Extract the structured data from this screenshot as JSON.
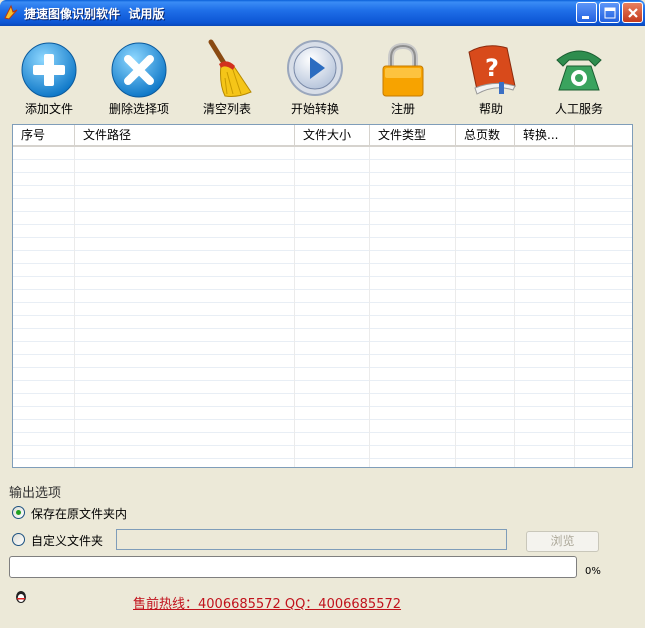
{
  "window": {
    "title": "捷速图像识别软件  试用版"
  },
  "toolbar": {
    "items": [
      {
        "label": "添加文件",
        "icon": "plus-icon"
      },
      {
        "label": "删除选择项",
        "icon": "delete-x-icon"
      },
      {
        "label": "清空列表",
        "icon": "broom-icon"
      },
      {
        "label": "开始转换",
        "icon": "play-icon"
      },
      {
        "label": "注册",
        "icon": "lock-icon"
      },
      {
        "label": "帮助",
        "icon": "help-book-icon"
      },
      {
        "label": "人工服务",
        "icon": "telephone-icon"
      }
    ]
  },
  "file_list": {
    "columns": [
      "序号",
      "文件路径",
      "文件大小",
      "文件类型",
      "总页数",
      "转换..."
    ],
    "rows": []
  },
  "output": {
    "title": "输出选项",
    "option_original": "保存在原文件夹内",
    "option_custom": "自定义文件夹",
    "selected": "保存在原文件夹内",
    "custom_path": "",
    "browse_label": "浏览"
  },
  "progress": {
    "value": 0,
    "label": "0%"
  },
  "footer": {
    "hotline": "售前热线：4006685572 QQ：4006685572",
    "qq_prefix": "Q"
  },
  "colors": {
    "titlebar": "#0c55d4",
    "radio_dot": "#21a121",
    "hotline": "#c1121c"
  }
}
